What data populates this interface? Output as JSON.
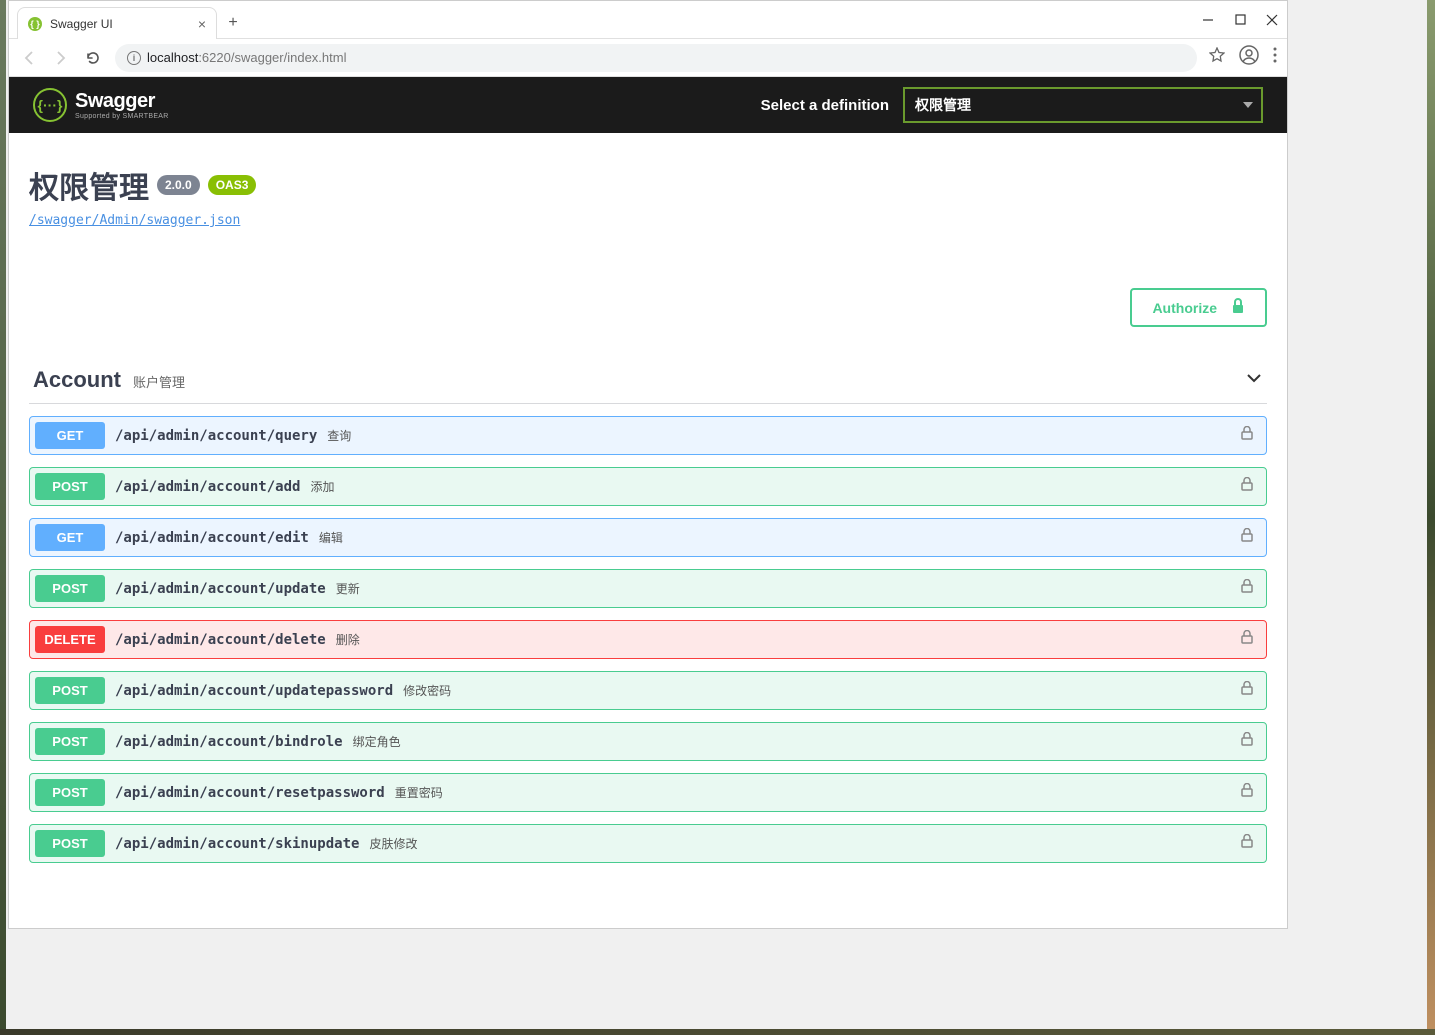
{
  "browser": {
    "tab_title": "Swagger UI",
    "url_host": "localhost",
    "url_port": ":6220",
    "url_path": "/swagger/index.html"
  },
  "topbar": {
    "logo_main": "Swagger",
    "logo_sub": "Supported by SMARTBEAR",
    "select_label": "Select a definition",
    "select_value": "权限管理"
  },
  "info": {
    "title": "权限管理",
    "version": "2.0.0",
    "oas": "OAS3",
    "link": "/swagger/Admin/swagger.json"
  },
  "authorize_label": "Authorize",
  "tag": {
    "name": "Account",
    "desc": "账户管理"
  },
  "operations": [
    {
      "method": "GET",
      "cls": "get",
      "path": "/api/admin/account/query",
      "summary": "查询"
    },
    {
      "method": "POST",
      "cls": "post",
      "path": "/api/admin/account/add",
      "summary": "添加"
    },
    {
      "method": "GET",
      "cls": "get",
      "path": "/api/admin/account/edit",
      "summary": "编辑"
    },
    {
      "method": "POST",
      "cls": "post",
      "path": "/api/admin/account/update",
      "summary": "更新"
    },
    {
      "method": "DELETE",
      "cls": "delete",
      "path": "/api/admin/account/delete",
      "summary": "删除"
    },
    {
      "method": "POST",
      "cls": "post",
      "path": "/api/admin/account/updatepassword",
      "summary": "修改密码"
    },
    {
      "method": "POST",
      "cls": "post",
      "path": "/api/admin/account/bindrole",
      "summary": "绑定角色"
    },
    {
      "method": "POST",
      "cls": "post",
      "path": "/api/admin/account/resetpassword",
      "summary": "重置密码"
    },
    {
      "method": "POST",
      "cls": "post",
      "path": "/api/admin/account/skinupdate",
      "summary": "皮肤修改"
    }
  ]
}
